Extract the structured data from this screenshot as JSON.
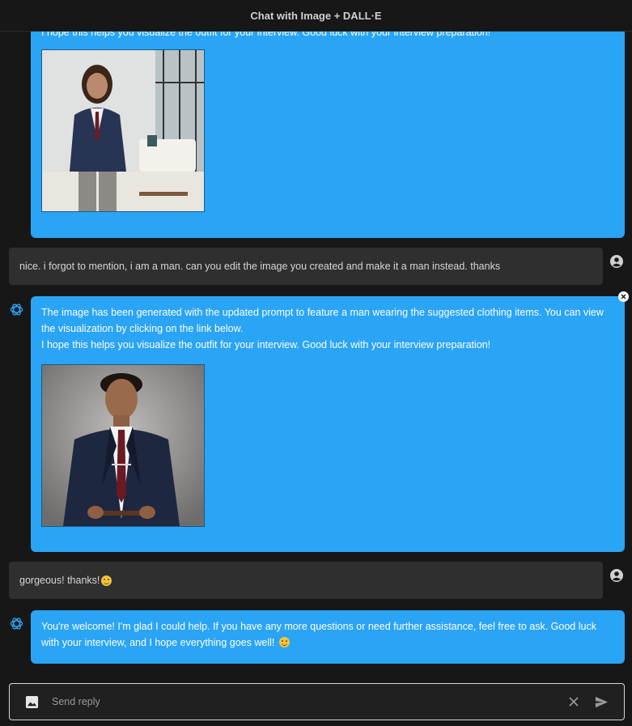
{
  "app": {
    "title": "Chat with Image + DALL·E"
  },
  "messages": {
    "m1": {
      "role": "assistant",
      "line1": "I hope this helps you visualize the outfit for your interview. Good luck with your interview preparation!",
      "image": "generated-woman-suit-image"
    },
    "m2": {
      "role": "user",
      "text": "nice. i forgot to mention, i am a man. can you edit the image you created and make it a man instead. thanks"
    },
    "m3": {
      "role": "assistant",
      "line1": "The image has been generated with the updated prompt to feature a man wearing the suggested clothing items. You can view the visualization by clicking on the link below.",
      "line2": "I hope this helps you visualize the outfit for your interview. Good luck with your interview preparation!",
      "image": "generated-man-suit-image"
    },
    "m4": {
      "role": "user",
      "text": "gorgeous! thanks! ",
      "emoji": "relieved-face-emoji"
    },
    "m5": {
      "role": "assistant",
      "text": "You're welcome! I'm glad I could help. If you have any more questions or need further assistance, feel free to ask. Good luck with your interview, and I hope everything goes well! ",
      "emoji": "smiling-face-emoji"
    }
  },
  "composer": {
    "placeholder": "Send reply"
  },
  "icons": {
    "bot_avatar": "openai-logo-icon",
    "user_avatar": "user-account-icon",
    "image_upload": "image-icon",
    "clear": "close-icon",
    "send": "send-icon"
  },
  "colors": {
    "assistant_bubble": "#2aa4f4",
    "user_bubble": "#2f2f2f",
    "background": "#171717"
  }
}
